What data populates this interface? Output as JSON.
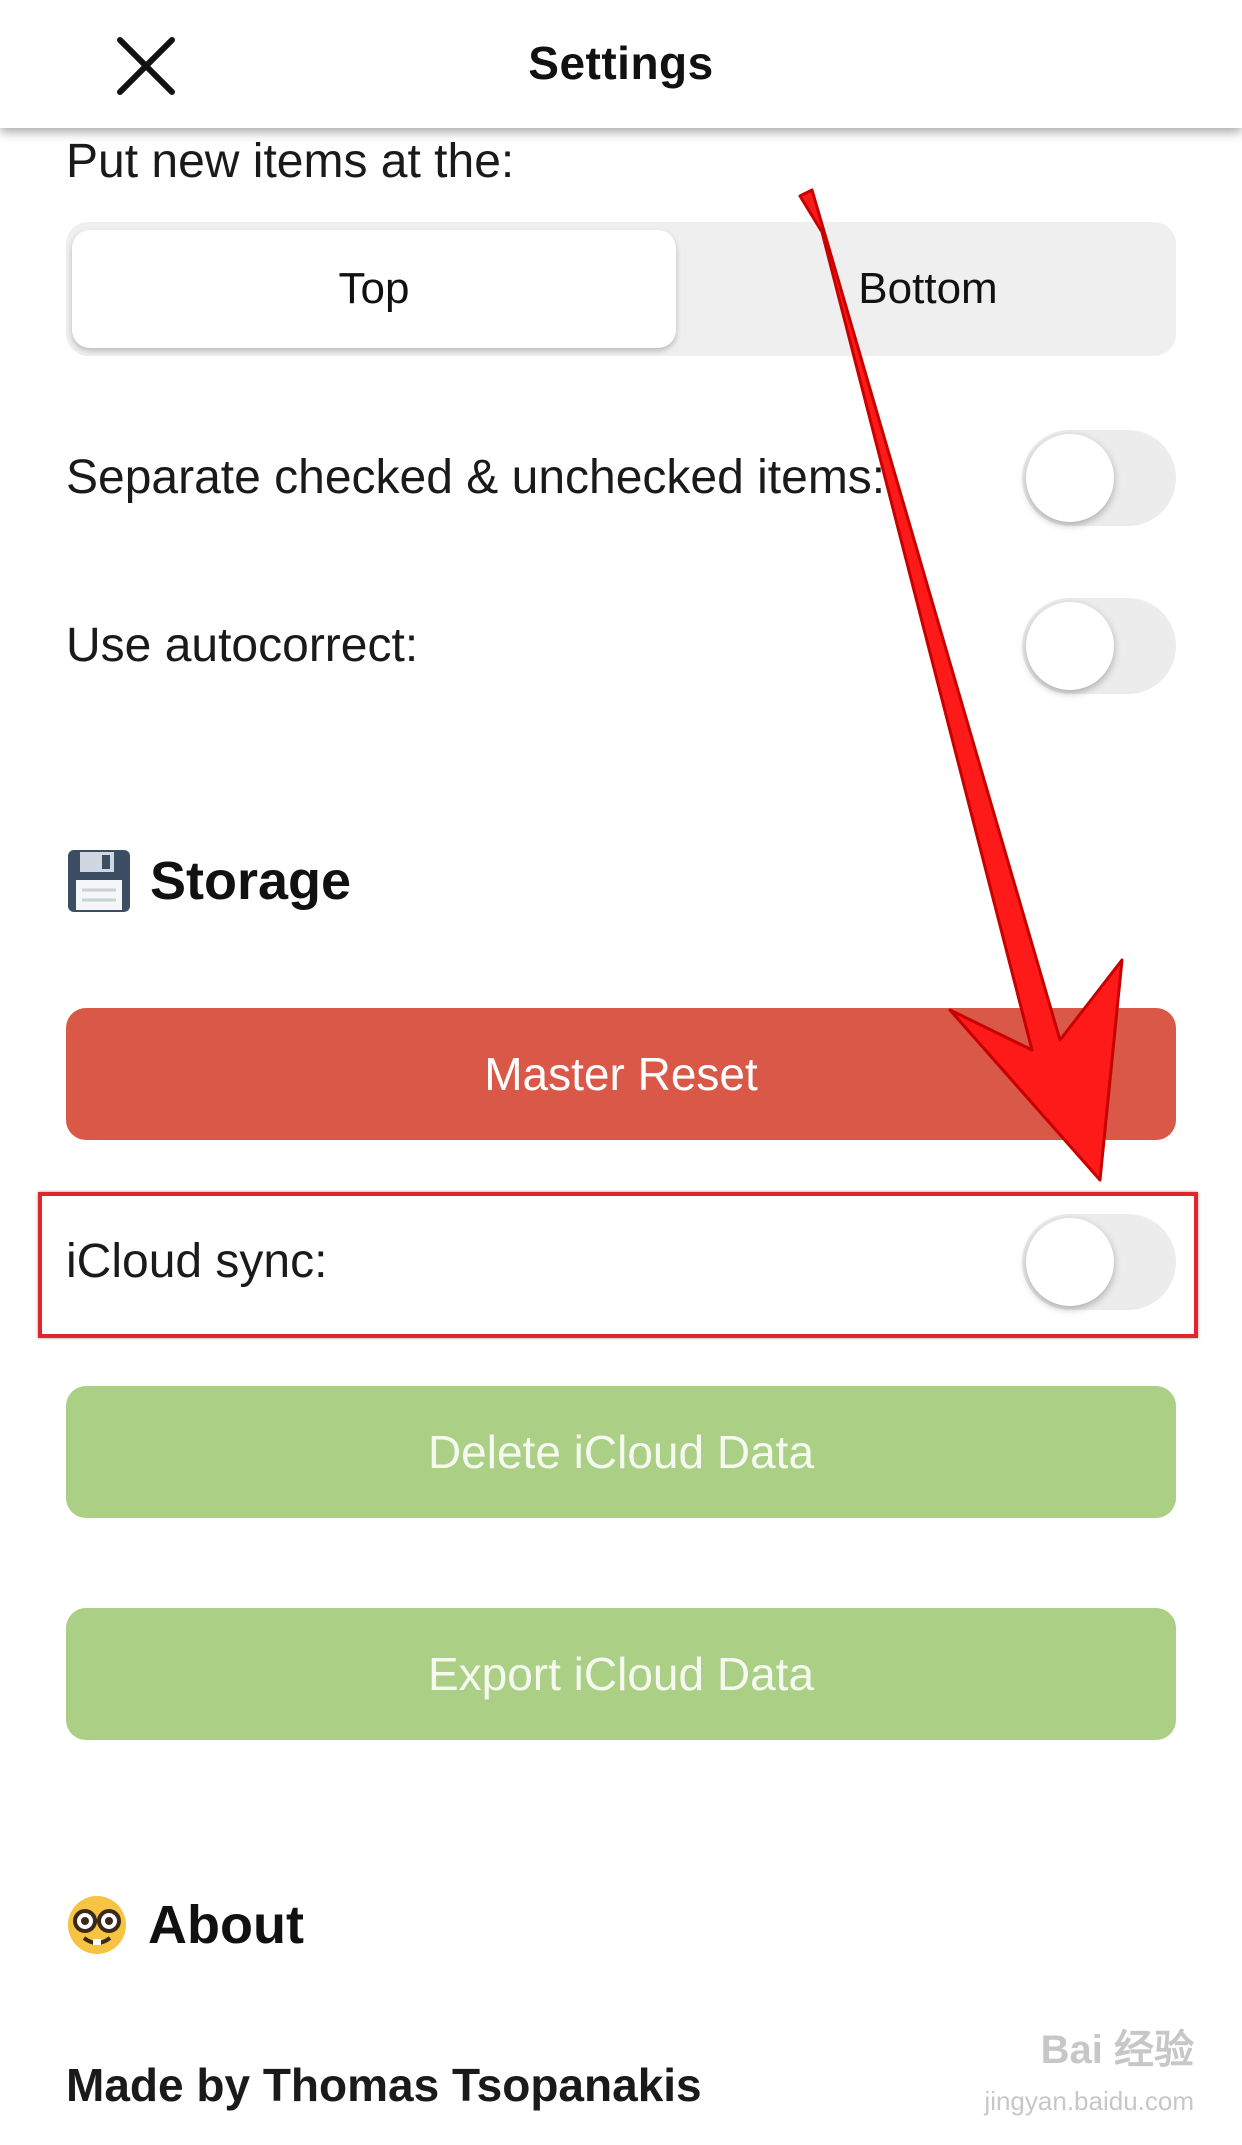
{
  "header": {
    "title": "Settings",
    "close_icon": "close-icon"
  },
  "placement": {
    "label": "Put new items at the:",
    "options": [
      "Top",
      "Bottom"
    ],
    "selected": "Top"
  },
  "toggles": {
    "separate_label": "Separate checked & unchecked items:",
    "separate_on": false,
    "autocorrect_label": "Use autocorrect:",
    "autocorrect_on": false,
    "icloud_label": "iCloud sync:",
    "icloud_on": false
  },
  "storage": {
    "icon": "floppy-disk-icon",
    "title": "Storage",
    "master_reset": "Master Reset",
    "delete_icloud": "Delete iCloud Data",
    "export_icloud": "Export iCloud Data"
  },
  "about": {
    "icon": "nerd-face-icon",
    "title": "About",
    "made_by": "Made by Thomas Tsopanakis"
  },
  "watermark": {
    "brand": "Bai 经验",
    "url": "jingyan.baidu.com"
  },
  "colors": {
    "danger": "#d95847",
    "success": "#aacf85",
    "annotation": "#e0252b"
  }
}
